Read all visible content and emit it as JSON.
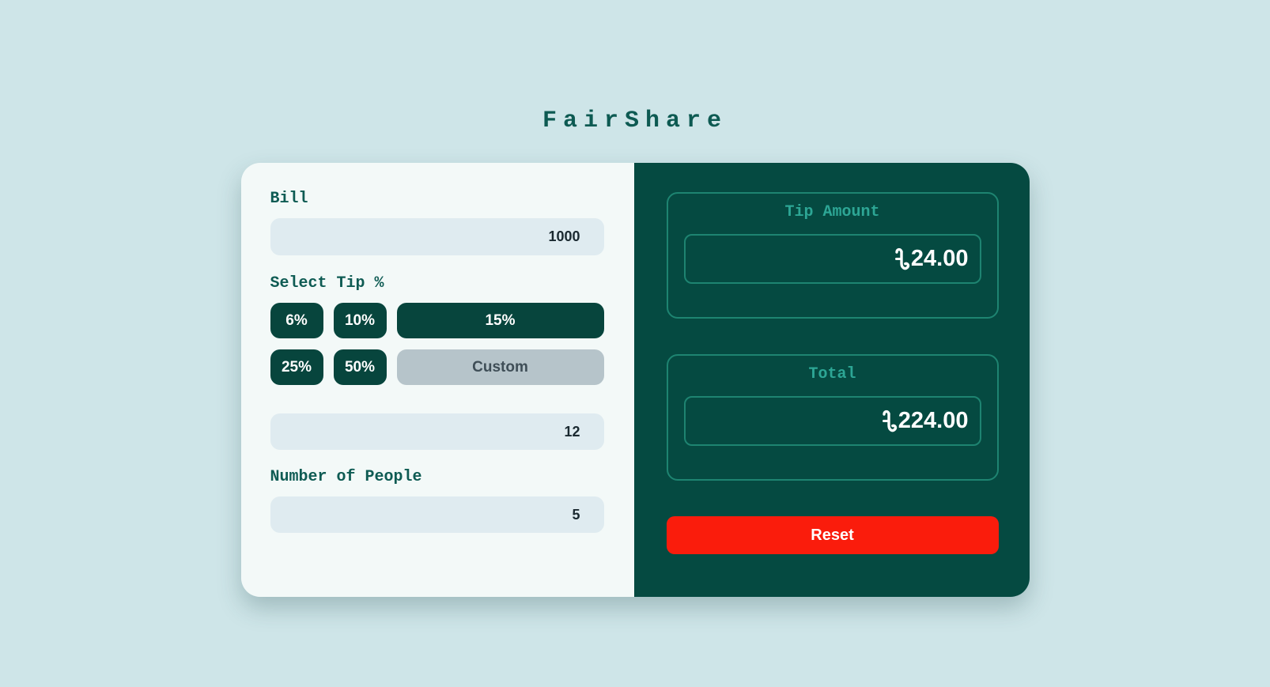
{
  "app": {
    "title": "FairShare"
  },
  "bill": {
    "label": "Bill",
    "value": "1000"
  },
  "tip": {
    "label": "Select Tip %",
    "options": [
      {
        "label": "6%"
      },
      {
        "label": "10%"
      },
      {
        "label": "15%"
      },
      {
        "label": "25%"
      },
      {
        "label": "50%"
      }
    ],
    "custom_placeholder": "Custom",
    "custom_value": "12"
  },
  "people": {
    "label": "Number of People",
    "value": "5"
  },
  "results": {
    "tip_amount": {
      "label": "Tip Amount",
      "currency_symbol": "৳",
      "value": "24.00"
    },
    "total": {
      "label": "Total",
      "currency_symbol": "৳",
      "value": "224.00"
    }
  },
  "reset_label": "Reset",
  "colors": {
    "page_background": "#cee5e8",
    "title_text": "#0d5a52",
    "left_panel_background": "#f3f9f8",
    "input_background": "#dfebf0",
    "tip_button_background": "#07453d",
    "custom_button_background": "#b6c4ca",
    "right_panel_background": "#054a41",
    "result_border": "#1e8471",
    "result_label_text": "#2da695",
    "reset_button_background": "#fa1c0c"
  }
}
